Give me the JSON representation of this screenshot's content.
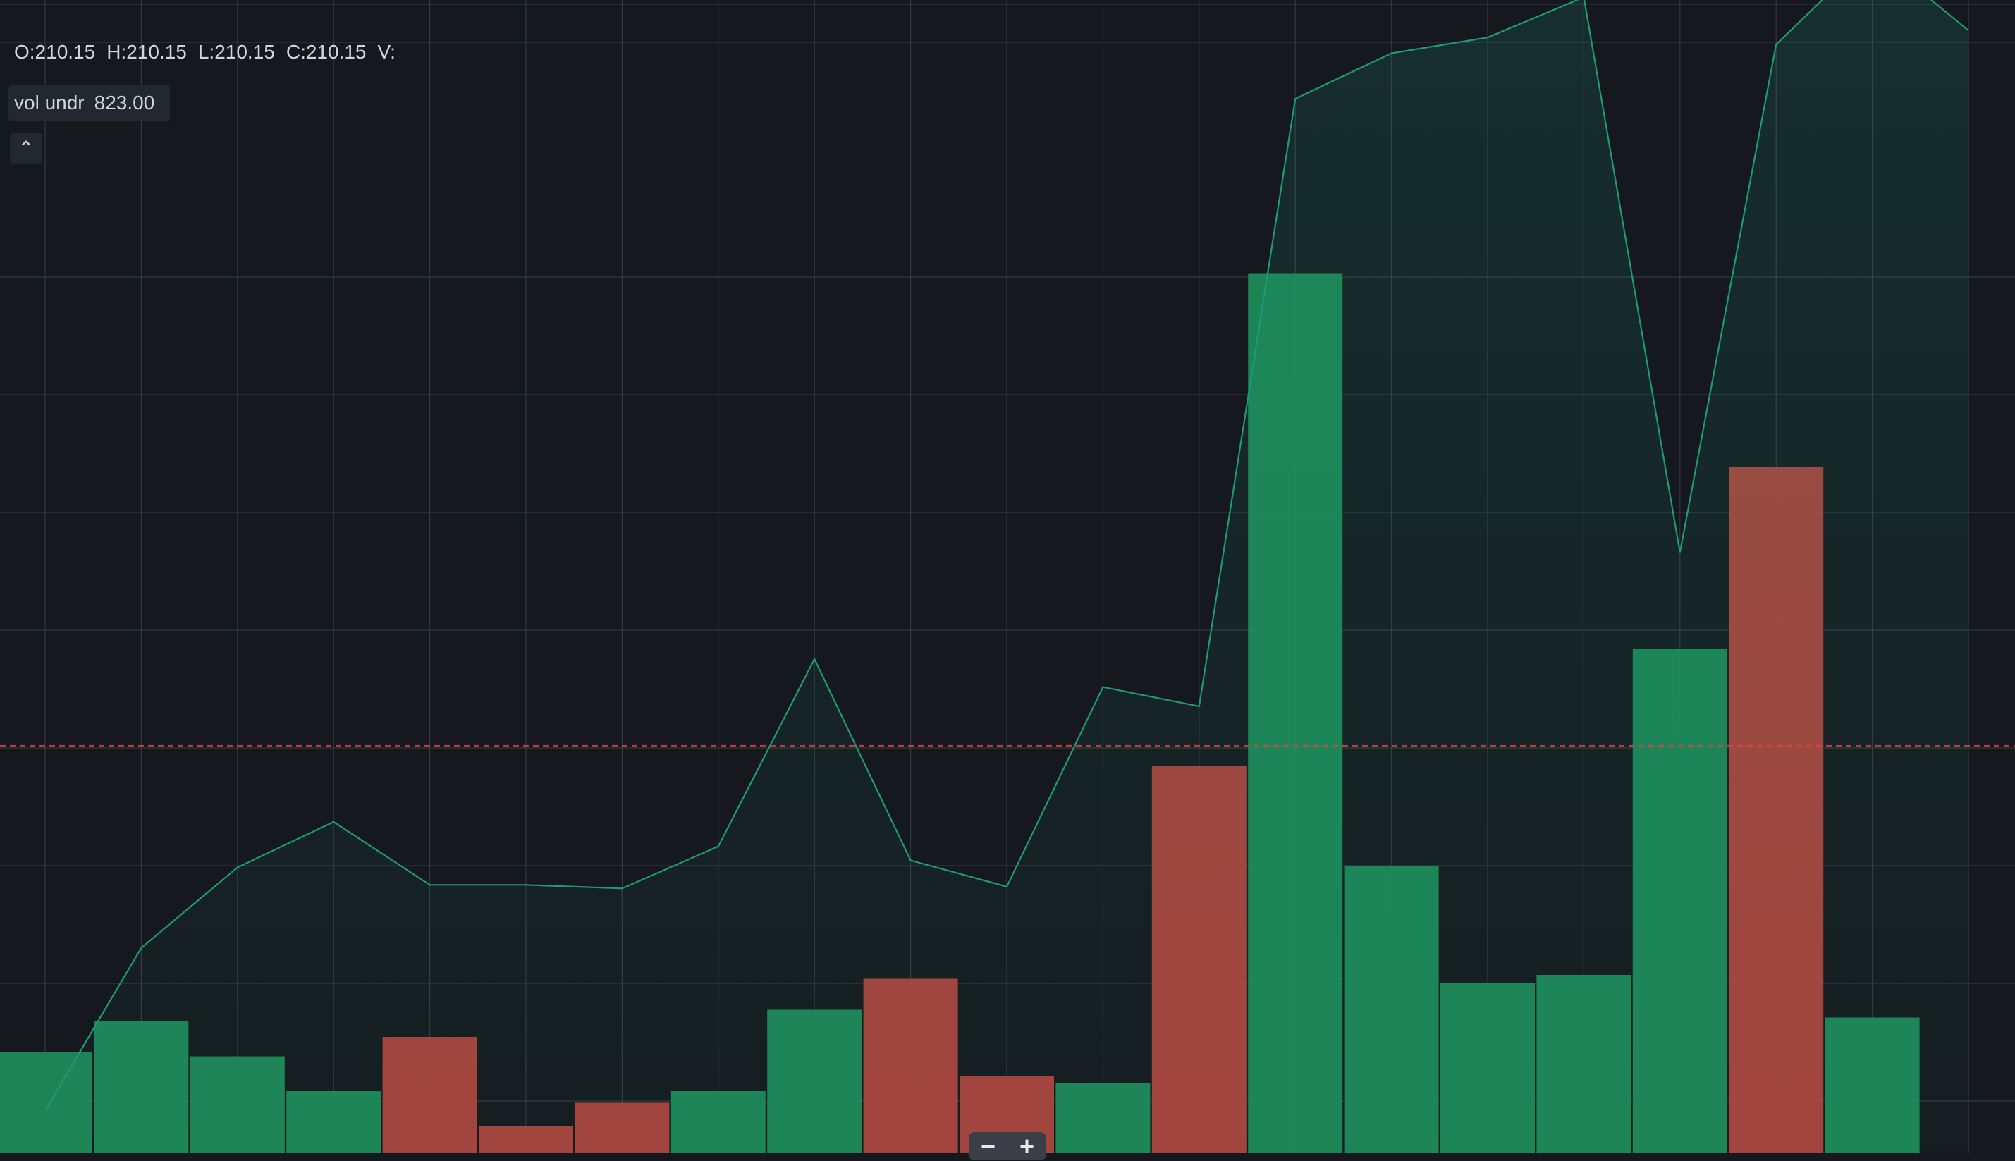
{
  "legend": {
    "open": "O:210.15",
    "high": "H:210.15",
    "low": "L:210.15",
    "close": "C:210.15",
    "volume": "V:"
  },
  "volume_indicator": {
    "name": "vol undr",
    "value": "823.00"
  },
  "controls": {
    "collapse_icon": "chevron-up-icon",
    "zoom_out": "−",
    "zoom_in": "+"
  },
  "colors": {
    "background": "#15181d",
    "line": "#1d9a7a",
    "up": "#1e8a58",
    "down": "#b0433d",
    "grid": "#3a3f48",
    "price_line": "#e0414b"
  },
  "chart_data": [
    {
      "type": "area",
      "title": "",
      "grid": true,
      "price_line_value": 210.15,
      "values": [
        189.3,
        198.6,
        203.2,
        205.8,
        202.2,
        202.2,
        202.0,
        204.4,
        215.1,
        203.6,
        202.1,
        213.5,
        212.4,
        247.1,
        249.7,
        250.6,
        252.9,
        221.2,
        250.2,
        255.5,
        251.0
      ]
    },
    {
      "type": "bar",
      "title": "",
      "values": [
        260,
        340,
        250,
        160,
        300,
        70,
        130,
        160,
        370,
        450,
        200,
        180,
        1000,
        2270,
        740,
        440,
        460,
        1300,
        1770,
        350
      ],
      "direction": [
        "up",
        "up",
        "up",
        "up",
        "down",
        "down",
        "down",
        "up",
        "up",
        "down",
        "down",
        "up",
        "down",
        "up",
        "up",
        "up",
        "up",
        "up",
        "down",
        "up"
      ]
    }
  ]
}
